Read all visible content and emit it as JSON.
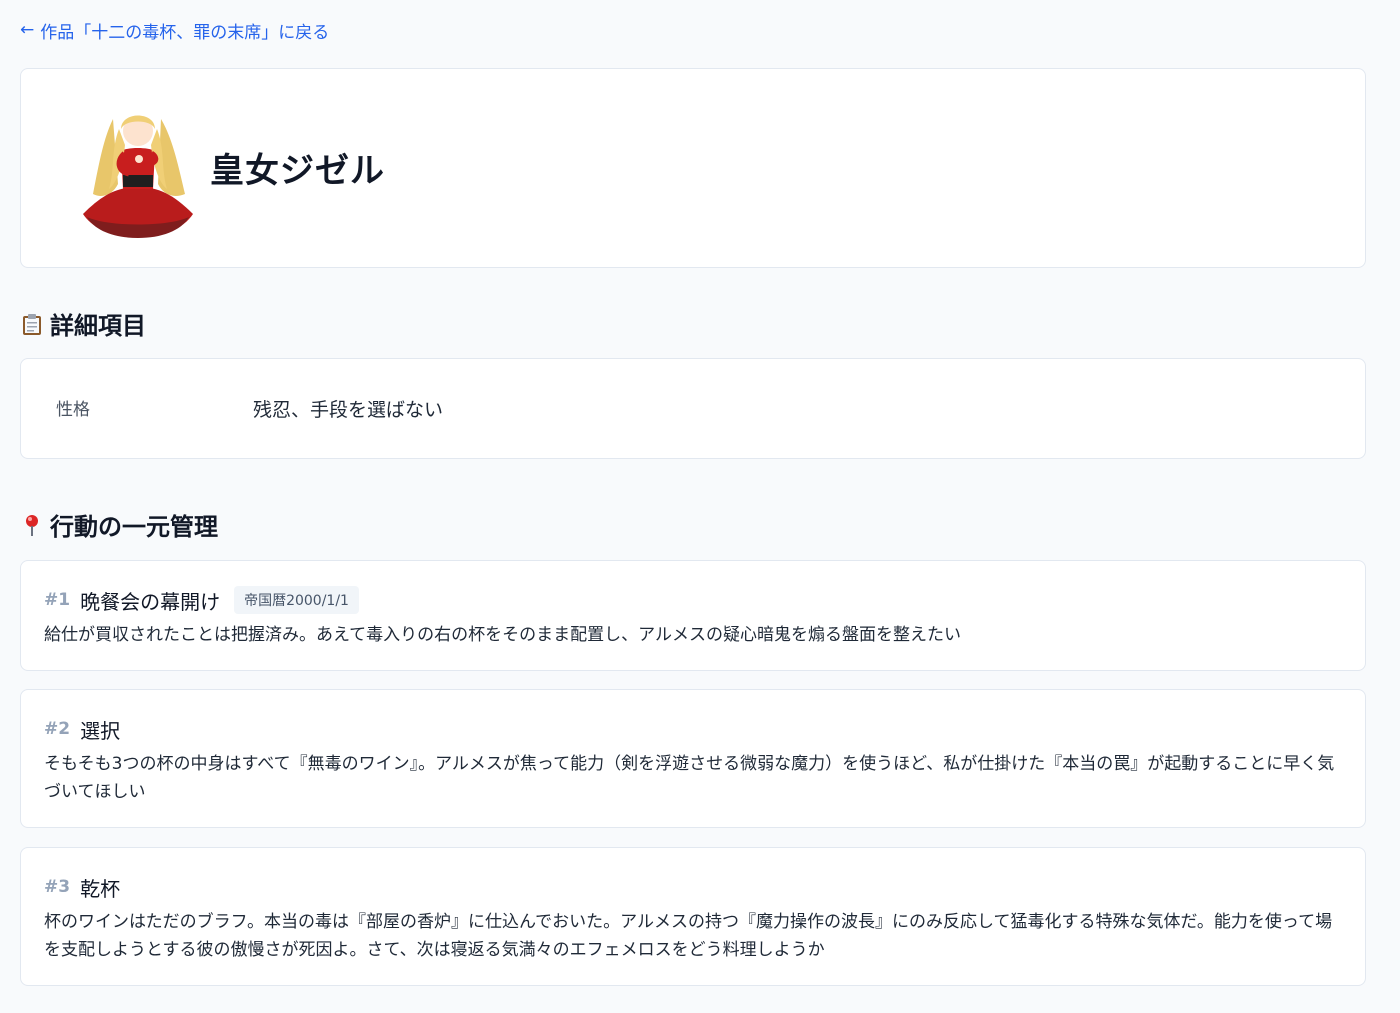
{
  "nav": {
    "back_label": "作品「十二の毒杯、罪の末席」に戻る"
  },
  "character": {
    "name": "皇女ジゼル"
  },
  "details_section": {
    "title": "詳細項目",
    "items": [
      {
        "label": "性格",
        "value": "残忍、手段を選ばない"
      }
    ]
  },
  "actions_section": {
    "title": "行動の一元管理",
    "actions": [
      {
        "number": "#1",
        "title": "晩餐会の幕開け",
        "tag": "帝国暦2000/1/1",
        "body": "給仕が買収されたことは把握済み。あえて毒入りの右の杯をそのまま配置し、アルメスの疑心暗鬼を煽る盤面を整えたい"
      },
      {
        "number": "#2",
        "title": "選択",
        "body": "そもそも3つの杯の中身はすべて『無毒のワイン』。アルメスが焦って能力（剣を浮遊させる微弱な魔力）を使うほど、私が仕掛けた『本当の罠』が起動することに早く気づいてほしい"
      },
      {
        "number": "#3",
        "title": "乾杯",
        "body": "杯のワインはただのブラフ。本当の毒は『部屋の香炉』に仕込んでおいた。アルメスの持つ『魔力操作の波長』にのみ反応して猛毒化する特殊な気体だ。能力を使って場を支配しようとする彼の傲慢さが死因よ。さて、次は寝返る気満々のエフェメロスをどう料理しようか"
      }
    ]
  },
  "colors": {
    "link": "#2563eb",
    "accent_pin": "#dc2626"
  }
}
